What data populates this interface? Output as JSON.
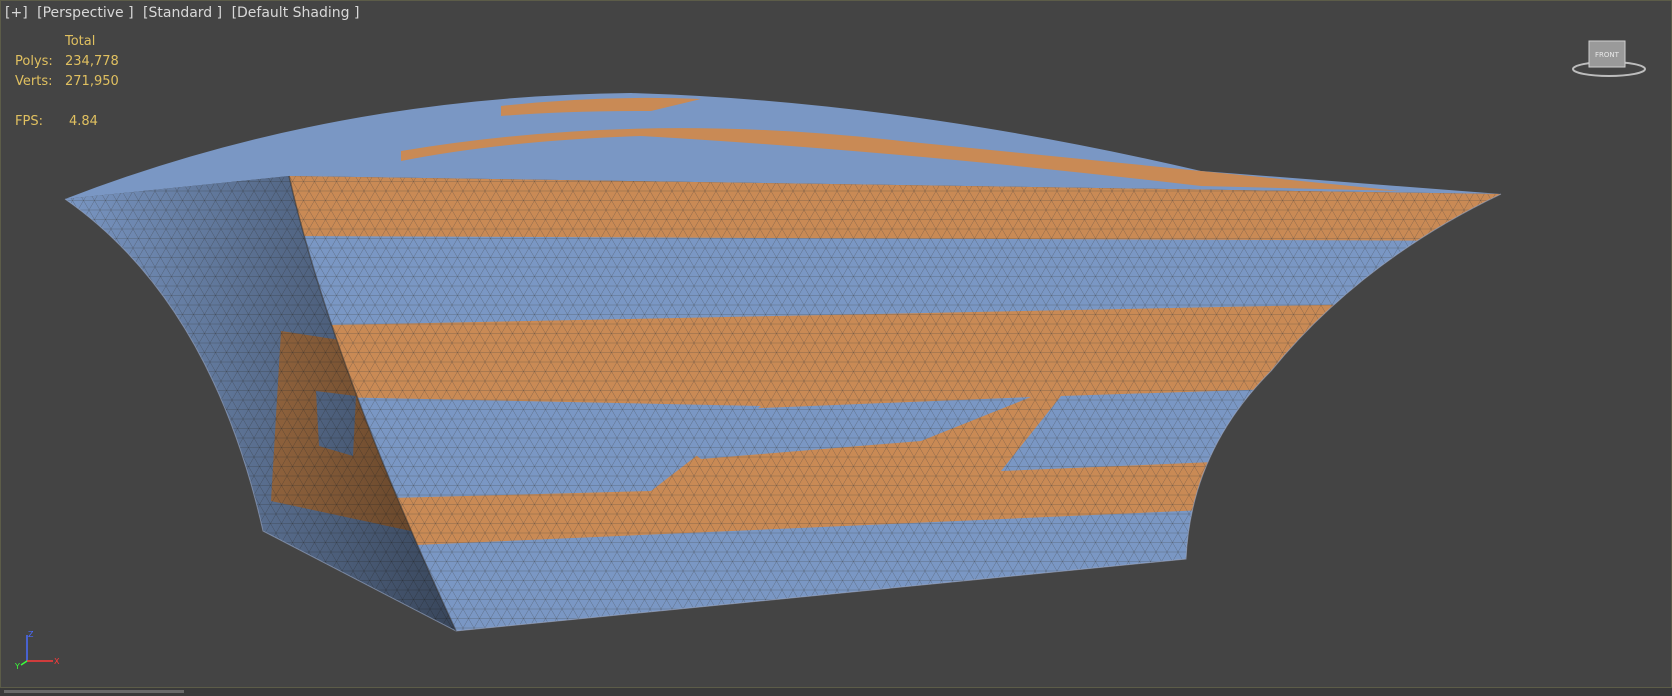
{
  "viewport": {
    "labels": [
      "[+]",
      "[Perspective ]",
      "[Standard ]",
      "[Default Shading ]"
    ],
    "border_color": "#5c5c48"
  },
  "stats": {
    "header": "Total",
    "polys_label": "Polys:",
    "polys_value": "234,778",
    "verts_label": "Verts:",
    "verts_value": "271,950",
    "fps_label": "FPS:",
    "fps_value": "4.84",
    "color": "#e0c060"
  },
  "viewcube": {
    "face_label": "FRONT",
    "icon": "viewcube-icon"
  },
  "axis_gizmo": {
    "z": "Z",
    "x": "X",
    "y": "Y"
  },
  "colors": {
    "background": "#444444",
    "orange": "#c98a55",
    "blue": "#7a97c4"
  }
}
